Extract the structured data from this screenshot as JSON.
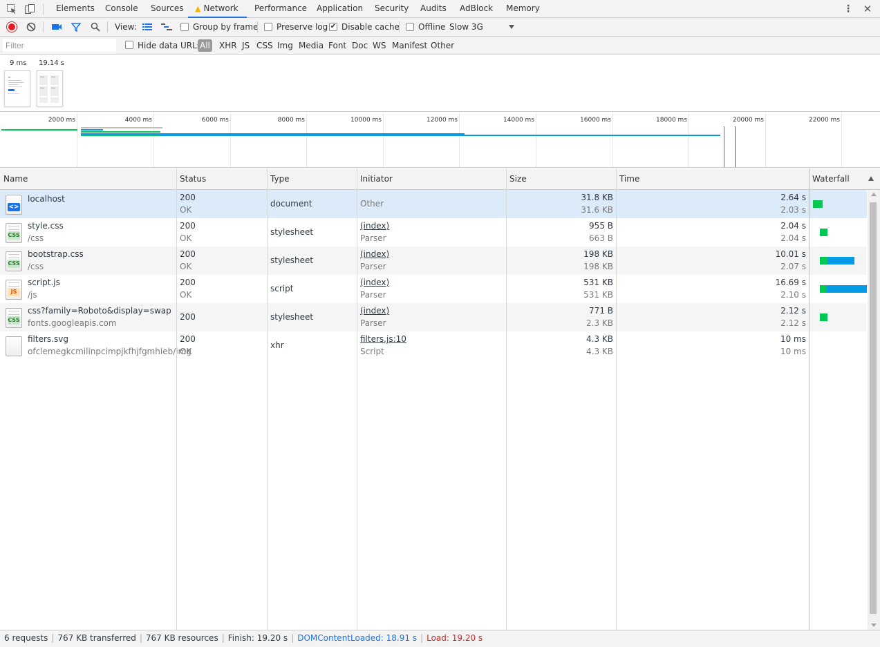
{
  "tabs": [
    "Elements",
    "Console",
    "Sources",
    "Network",
    "Performance",
    "Application",
    "Security",
    "Audits",
    "AdBlock",
    "Memory"
  ],
  "active_tab": "Network",
  "toolbar": {
    "view_label": "View:",
    "group_by_frame": "Group by frame",
    "preserve_log": "Preserve log",
    "disable_cache": "Disable cache",
    "disable_cache_checked": true,
    "offline": "Offline",
    "throttling": "Slow 3G"
  },
  "filterbar": {
    "placeholder": "Filter",
    "hide_data_urls": "Hide data URLs",
    "types": [
      "All",
      "XHR",
      "JS",
      "CSS",
      "Img",
      "Media",
      "Font",
      "Doc",
      "WS",
      "Manifest",
      "Other"
    ]
  },
  "filmstrip": {
    "frames": [
      "9 ms",
      "19.14 s"
    ]
  },
  "overview": {
    "ticks": [
      "2000 ms",
      "4000 ms",
      "6000 ms",
      "8000 ms",
      "10000 ms",
      "12000 ms",
      "14000 ms",
      "16000 ms",
      "18000 ms",
      "20000 ms",
      "22000 ms"
    ]
  },
  "columns": [
    "Name",
    "Status",
    "Type",
    "Initiator",
    "Size",
    "Time",
    "Waterfall"
  ],
  "requests": [
    {
      "name": "localhost",
      "path": "",
      "status": "200",
      "status_text": "OK",
      "type": "document",
      "initiator": "Other",
      "initiator_sub": "",
      "size": "31.8 KB",
      "size_sub": "31.6 KB",
      "time": "2.64 s",
      "time_sub": "2.03 s",
      "icon": "document-icon"
    },
    {
      "name": "style.css",
      "path": "/css",
      "status": "200",
      "status_text": "OK",
      "type": "stylesheet",
      "initiator": "(index)",
      "initiator_sub": "Parser",
      "size": "955 B",
      "size_sub": "663 B",
      "time": "2.04 s",
      "time_sub": "2.04 s",
      "icon": "css-file-icon"
    },
    {
      "name": "bootstrap.css",
      "path": "/css",
      "status": "200",
      "status_text": "OK",
      "type": "stylesheet",
      "initiator": "(index)",
      "initiator_sub": "Parser",
      "size": "198 KB",
      "size_sub": "198 KB",
      "time": "10.01 s",
      "time_sub": "2.07 s",
      "icon": "css-file-icon"
    },
    {
      "name": "script.js",
      "path": "/js",
      "status": "200",
      "status_text": "OK",
      "type": "script",
      "initiator": "(index)",
      "initiator_sub": "Parser",
      "size": "531 KB",
      "size_sub": "531 KB",
      "time": "16.69 s",
      "time_sub": "2.10 s",
      "icon": "js-file-icon"
    },
    {
      "name": "css?family=Roboto&display=swap",
      "path": "fonts.googleapis.com",
      "status": "200",
      "status_text": "",
      "type": "stylesheet",
      "initiator": "(index)",
      "initiator_sub": "Parser",
      "size": "771 B",
      "size_sub": "2.3 KB",
      "time": "2.12 s",
      "time_sub": "2.12 s",
      "icon": "css-file-icon"
    },
    {
      "name": "filters.svg",
      "path": "ofclemegkcmilinpcimpjkfhjfgmhieb/img",
      "status": "200",
      "status_text": "OK",
      "type": "xhr",
      "initiator": "filters.js:10",
      "initiator_sub": "Script",
      "size": "4.3 KB",
      "size_sub": "4.3 KB",
      "time": "10 ms",
      "time_sub": "10 ms",
      "icon": "blank-file-icon"
    }
  ],
  "status": {
    "requests": "6 requests",
    "transferred": "767 KB transferred",
    "resources": "767 KB resources",
    "finish": "Finish: 19.20 s",
    "dcl": "DOMContentLoaded: 18.91 s",
    "load": "Load: 19.20 s"
  },
  "colors": {
    "accent": "#1a73e8",
    "waiting": "#00c853",
    "download": "#039be5",
    "record": "#e81b23",
    "dcl_line": "#1a73e8",
    "load_line": "#c62828"
  }
}
